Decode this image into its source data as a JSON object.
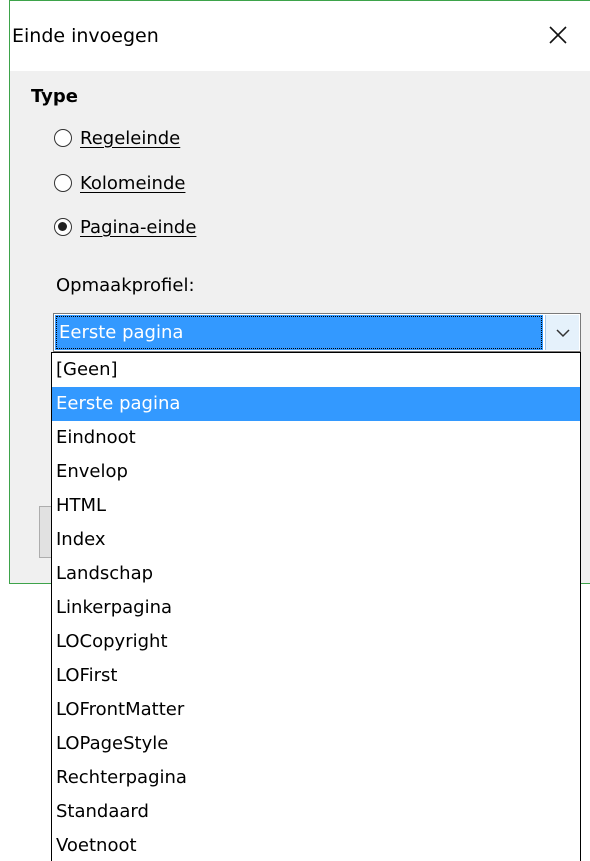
{
  "dialog": {
    "title": "Einde invoegen",
    "close_icon": "close-icon",
    "type_section": {
      "title": "Type",
      "options": [
        {
          "label": "Regeleinde",
          "checked": false
        },
        {
          "label": "Kolomeinde",
          "checked": false
        },
        {
          "label": "Pagina-einde",
          "checked": true
        }
      ]
    },
    "style_field": {
      "label": "Opmaakprofiel:",
      "value": "Eerste pagina",
      "arrow_icon": "chevron-down-icon"
    }
  },
  "dropdown": {
    "options": [
      "[Geen]",
      "Eerste pagina",
      "Eindnoot",
      "Envelop",
      "HTML",
      "Index",
      "Landschap",
      "Linkerpagina",
      "LOCopyright",
      "LOFirst",
      "LOFrontMatter",
      "LOPageStyle",
      "Rechterpagina",
      "Standaard",
      "Voetnoot"
    ],
    "selected": "Eerste pagina"
  },
  "colors": {
    "selection": "#3399ff",
    "window_border": "#3da34a",
    "dialog_background": "#f0f0f0"
  }
}
